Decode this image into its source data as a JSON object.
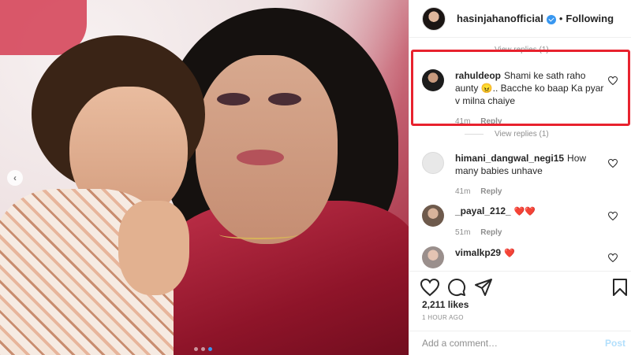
{
  "header": {
    "username": "hasinjahanofficial",
    "separator": "•",
    "follow_label": "Following"
  },
  "replies": {
    "view_replies_1": "View replies (1)",
    "view_replies_2": "View replies (1)"
  },
  "comments": [
    {
      "username": "rahuldeop",
      "text": "Shami ke sath raho aunty 😠.. Bacche ko baap Ka pyar v milna chaiye",
      "time": "41m",
      "reply_label": "Reply"
    },
    {
      "username": "himani_dangwal_negi15",
      "text": "How many babies unhave",
      "time": "41m",
      "reply_label": "Reply"
    },
    {
      "username": "_payal_212_",
      "text": "❤️❤️",
      "time": "51m",
      "reply_label": "Reply"
    },
    {
      "username": "vimalkp29",
      "text": "❤️",
      "time": "",
      "reply_label": ""
    }
  ],
  "likes": "2,211 likes",
  "timestamp": "1 HOUR AGO",
  "add_comment": {
    "placeholder": "Add a comment…",
    "post_label": "Post"
  },
  "colors": {
    "accent": "#3897f0",
    "highlight": "#e8222e",
    "post_disabled": "#b2dffc",
    "heart": "#ed4956"
  },
  "icons": [
    "chevron-left-icon",
    "verified-badge-icon",
    "heart-icon",
    "comment-icon",
    "share-icon",
    "bookmark-icon"
  ]
}
